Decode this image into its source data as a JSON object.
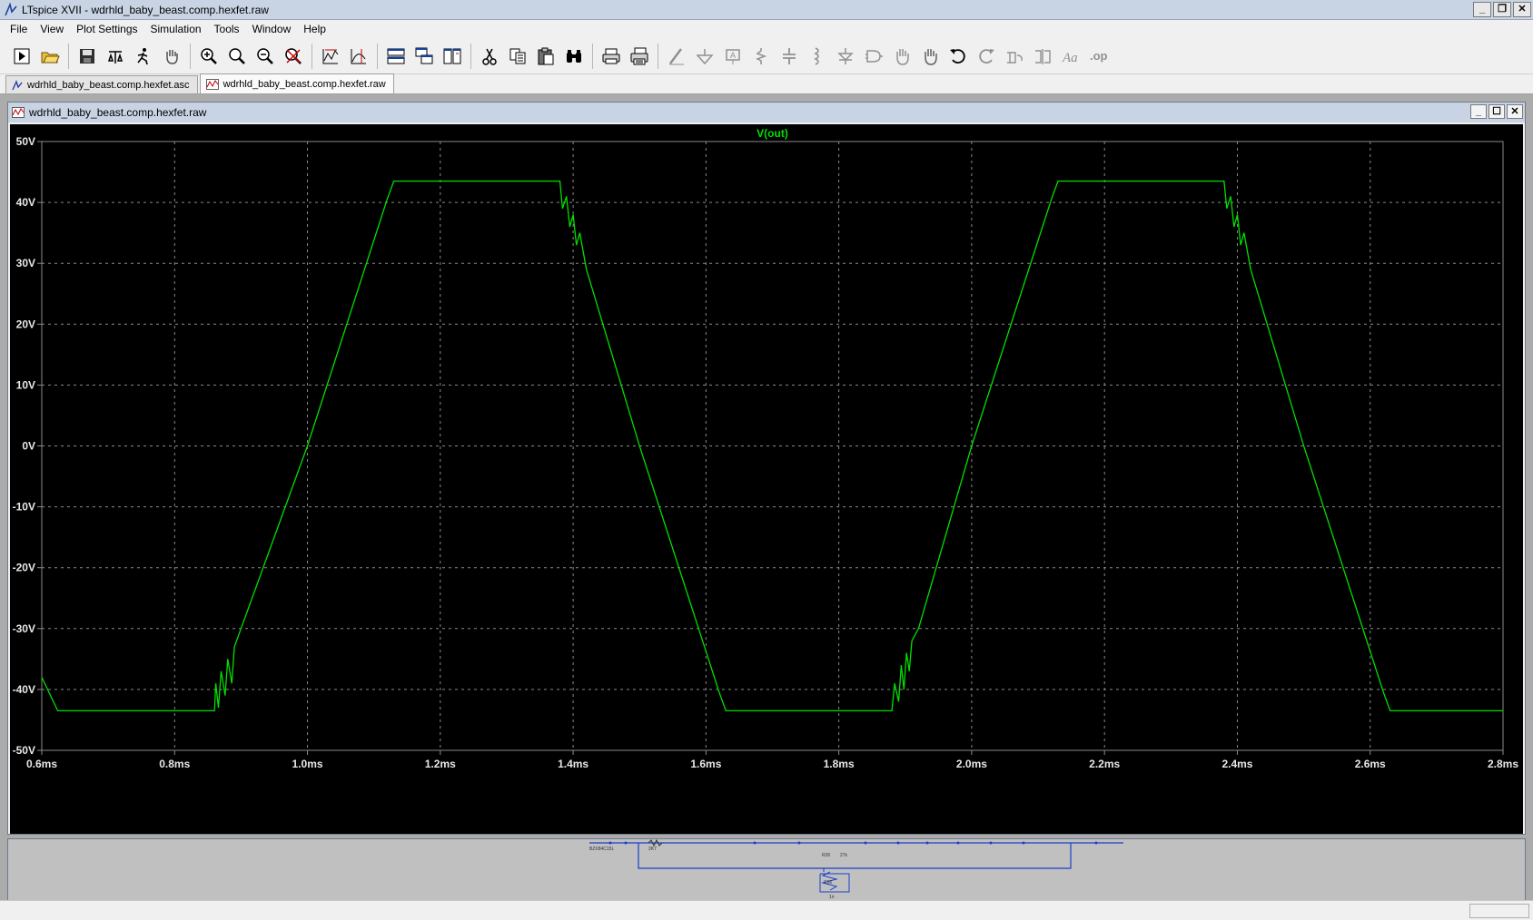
{
  "app": {
    "title": "LTspice XVII - wdrhld_baby_beast.comp.hexfet.raw",
    "window_buttons": [
      "minimize",
      "restore",
      "close"
    ]
  },
  "menu": [
    "File",
    "View",
    "Plot Settings",
    "Simulation",
    "Tools",
    "Window",
    "Help"
  ],
  "toolbar_icons": [
    "run-icon",
    "open-icon",
    "save-icon",
    "control-panel-icon",
    "run-sim-icon",
    "pan-icon",
    "zoom-in-icon",
    "zoom-area-icon",
    "zoom-out-icon",
    "zoom-fit-icon",
    "autorange-icon",
    "measure-icon",
    "tile-horizontal-icon",
    "cascade-icon",
    "tile-vertical-icon",
    "cut-icon",
    "copy-icon",
    "paste-icon",
    "find-icon",
    "print-icon",
    "print-setup-icon",
    "wire-icon",
    "ground-icon",
    "label-icon",
    "resistor-icon",
    "capacitor-icon",
    "inductor-icon",
    "diode-icon",
    "component-icon",
    "move-icon",
    "drag-icon",
    "undo-icon",
    "redo-icon",
    "rotate-icon",
    "mirror-icon",
    "text-icon",
    "spice-directive-icon"
  ],
  "tabs": [
    {
      "label": "wdrhld_baby_beast.comp.hexfet.asc",
      "type": "schematic"
    },
    {
      "label": "wdrhld_baby_beast.comp.hexfet.raw",
      "type": "waveform"
    }
  ],
  "child_window": {
    "title": "wdrhld_baby_beast.comp.hexfet.raw"
  },
  "colors": {
    "trace": "#00e000",
    "plot_bg": "#000000",
    "grid": "#8a8a8a",
    "axis_text": "#e8e8e8"
  },
  "chart_data": {
    "type": "line",
    "title": "",
    "series": [
      {
        "name": "V(out)",
        "x": [
          0.6,
          0.624,
          0.86,
          0.862,
          0.866,
          0.87,
          0.876,
          0.88,
          0.886,
          0.89,
          0.9,
          1.0,
          1.12,
          1.13,
          1.38,
          1.384,
          1.39,
          1.395,
          1.4,
          1.405,
          1.41,
          1.42,
          1.5,
          1.62,
          1.63,
          1.88,
          1.884,
          1.89,
          1.894,
          1.898,
          1.902,
          1.906,
          1.91,
          1.92,
          2.0,
          2.12,
          2.13,
          2.38,
          2.384,
          2.39,
          2.395,
          2.4,
          2.405,
          2.41,
          2.42,
          2.5,
          2.62,
          2.63,
          2.8
        ],
        "y": [
          -38,
          -43.5,
          -43.5,
          -39,
          -43,
          -37,
          -41,
          -35,
          -39,
          -33,
          -30,
          0,
          40.5,
          43.5,
          43.5,
          39,
          41,
          36,
          38,
          33,
          35,
          29,
          0,
          -40.5,
          -43.5,
          -43.5,
          -39,
          -42,
          -36,
          -40,
          -34,
          -37,
          -32,
          -30,
          0,
          40.5,
          43.5,
          43.5,
          39,
          41,
          36,
          38,
          33,
          35,
          29,
          0,
          -40.5,
          -43.5,
          -43.5
        ]
      }
    ],
    "legend": "top-center",
    "x_ticks": [
      "0.6ms",
      "0.8ms",
      "1.0ms",
      "1.2ms",
      "1.4ms",
      "1.6ms",
      "1.8ms",
      "2.0ms",
      "2.2ms",
      "2.4ms",
      "2.6ms",
      "2.8ms"
    ],
    "y_ticks": [
      "50V",
      "40V",
      "30V",
      "20V",
      "10V",
      "0V",
      "-10V",
      "-20V",
      "-30V",
      "-40V",
      "-50V"
    ],
    "xlim": [
      0.6,
      2.8
    ],
    "ylim": [
      -50,
      50
    ],
    "grid": true
  },
  "schematic_strip": {
    "labels": [
      "BZX84C15L",
      "2K7",
      "R26",
      "27k",
      "C16",
      "1n"
    ]
  }
}
